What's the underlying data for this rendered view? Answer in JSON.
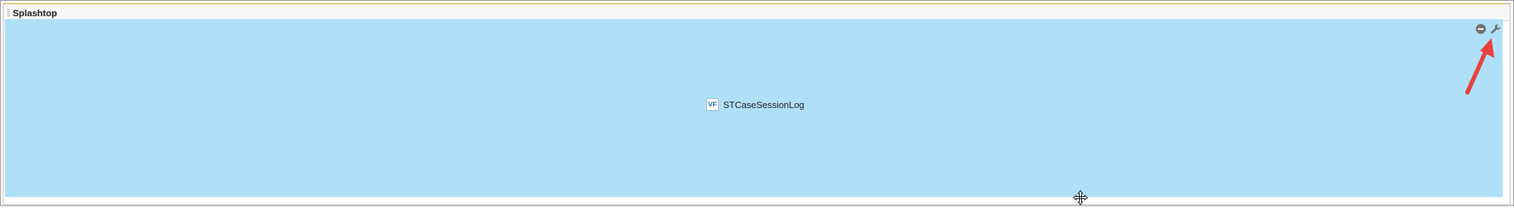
{
  "section": {
    "title": "Splashtop",
    "component_label": "STCaseSessionLog",
    "component_badge": "VF"
  },
  "icons": {
    "minus": "remove-icon",
    "wrench": "wrench-icon",
    "arrow": "annotation-arrow",
    "move": "move-cursor-icon"
  },
  "colors": {
    "canvas": "#b0e0f7",
    "arrow": "#e8413c",
    "icon_gray": "#7a7a7a"
  }
}
